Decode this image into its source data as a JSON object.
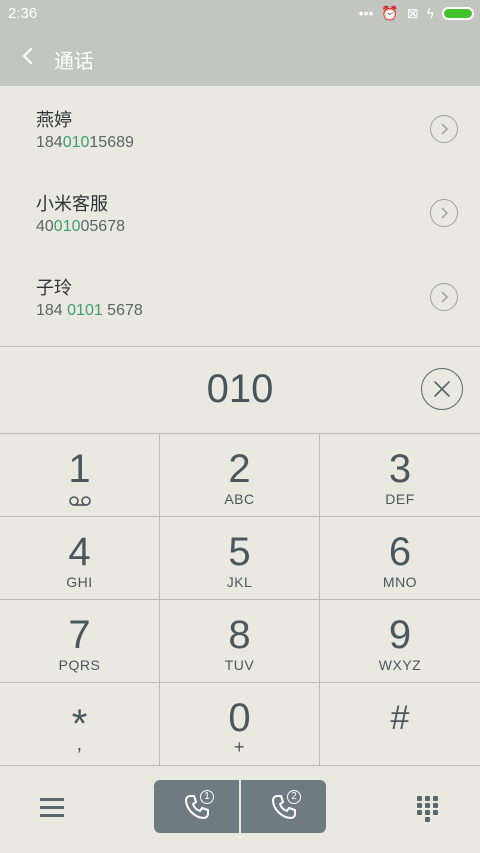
{
  "status_bar": {
    "time": "2:36",
    "icons": [
      "more-dots-icon",
      "alarm-icon",
      "sim-off-icon",
      "charging-icon",
      "battery-icon"
    ]
  },
  "header": {
    "title": "通话"
  },
  "contacts": [
    {
      "name": "燕婷",
      "number_pre": "184",
      "number_match": "010",
      "number_post": "15689"
    },
    {
      "name": "小米客服",
      "number_pre": "40",
      "number_match": "010",
      "number_post": "05678"
    },
    {
      "name": "子玲",
      "number_pre": "184 ",
      "number_match": "0101",
      "number_post": " 5678"
    }
  ],
  "dial_input": {
    "value": "010"
  },
  "keypad": [
    {
      "digit": "1",
      "letters": ""
    },
    {
      "digit": "2",
      "letters": "ABC"
    },
    {
      "digit": "3",
      "letters": "DEF"
    },
    {
      "digit": "4",
      "letters": "GHI"
    },
    {
      "digit": "5",
      "letters": "JKL"
    },
    {
      "digit": "6",
      "letters": "MNO"
    },
    {
      "digit": "7",
      "letters": "PQRS"
    },
    {
      "digit": "8",
      "letters": "TUV"
    },
    {
      "digit": "9",
      "letters": "WXYZ"
    },
    {
      "digit": "*",
      "letters": ","
    },
    {
      "digit": "0",
      "letters": "+"
    },
    {
      "digit": "#",
      "letters": ""
    }
  ],
  "call_buttons": [
    {
      "sim": "1"
    },
    {
      "sim": "2"
    }
  ],
  "colors": {
    "accent_match": "#3fa06a",
    "header_bg": "#c3c5c0",
    "call_button_bg": "#6e7b80",
    "battery": "#44c22e"
  }
}
